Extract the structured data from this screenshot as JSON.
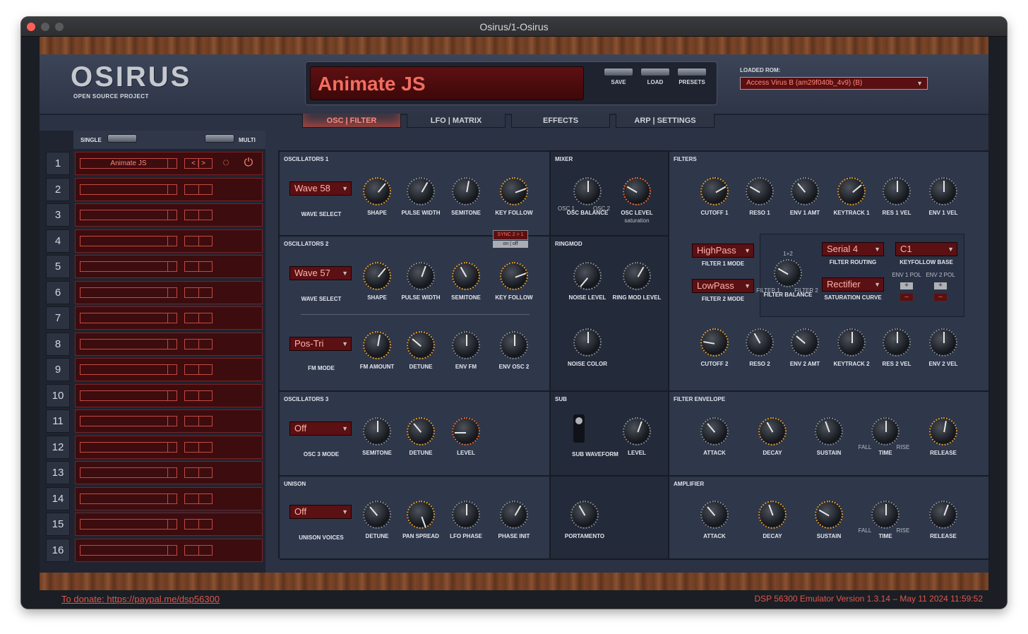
{
  "window": {
    "title": "Osirus/1-Osirus"
  },
  "header": {
    "logo": "OSIRUS",
    "logo_sub": "OPEN SOURCE PROJECT",
    "patch_name": "Animate JS",
    "buttons": [
      "SAVE",
      "LOAD",
      "PRESETS"
    ],
    "rom_label": "LOADED ROM:",
    "rom_value": "Access Virus B (am29f040b_4v9) (B)"
  },
  "tabs": [
    "OSC | FILTER",
    "LFO | MATRIX",
    "EFFECTS",
    "ARP | SETTINGS"
  ],
  "sidebar": {
    "single": "SINGLE",
    "multi": "MULTI",
    "slots": [
      "1",
      "2",
      "3",
      "4",
      "5",
      "6",
      "7",
      "8",
      "9",
      "10",
      "11",
      "12",
      "13",
      "14",
      "15",
      "16"
    ],
    "slot1_name": "Animate JS",
    "pm_label": "< | >"
  },
  "osc1": {
    "title": "OSCILLATORS 1",
    "wave": "Wave 58",
    "labels": [
      "WAVE SELECT",
      "SHAPE",
      "PULSE WIDTH",
      "SEMITONE",
      "KEY FOLLOW"
    ]
  },
  "osc2": {
    "title": "OSCILLATORS 2",
    "wave": "Wave 57",
    "labels": [
      "WAVE SELECT",
      "SHAPE",
      "PULSE WIDTH",
      "SEMITONE",
      "KEY FOLLOW"
    ],
    "sync": "SYNC 2 > 1",
    "onoff": "on | off",
    "fm_mode": "Pos-Tri",
    "labels2": [
      "FM MODE",
      "FM AMOUNT",
      "DETUNE",
      "ENV FM",
      "ENV OSC 2"
    ]
  },
  "osc3": {
    "title": "OSCILLATORS 3",
    "mode": "Off",
    "labels": [
      "OSC 3 MODE",
      "SEMITONE",
      "DETUNE",
      "LEVEL"
    ]
  },
  "unison": {
    "title": "UNISON",
    "voices": "Off",
    "labels": [
      "UNISON VOICES",
      "DETUNE",
      "PAN SPREAD",
      "LFO PHASE",
      "PHASE INIT"
    ]
  },
  "mixer": {
    "title": "MIXER",
    "labels": [
      "OSC BALANCE",
      "OSC LEVEL"
    ],
    "sat": "saturation",
    "osc1": "OSC 1",
    "osc2": "OSC 2"
  },
  "ringmod": {
    "title": "RINGMOD",
    "labels": [
      "NOISE LEVEL",
      "RING MOD LEVEL",
      "NOISE COLOR"
    ]
  },
  "sub": {
    "title": "SUB",
    "labels": [
      "SUB WAVEFORM",
      "LEVEL"
    ]
  },
  "portamento": {
    "label": "PORTAMENTO"
  },
  "filters": {
    "title": "FILTERS",
    "row1": [
      "CUTOFF 1",
      "RESO 1",
      "ENV 1 AMT",
      "KEYTRACK 1",
      "RES 1 VEL",
      "ENV 1 VEL"
    ],
    "row2": [
      "CUTOFF 2",
      "RESO 2",
      "ENV 2 AMT",
      "KEYTRACK 2",
      "RES 2 VEL",
      "ENV 2 VEL"
    ],
    "f1mode": "HighPass",
    "f1mode_lbl": "FILTER 1 MODE",
    "f2mode": "LowPass",
    "f2mode_lbl": "FILTER 2 MODE",
    "balance_lbl": "FILTER BALANCE",
    "routing": "Serial 4",
    "routing_lbl": "FILTER ROUTING",
    "sat": "Rectifier",
    "sat_lbl": "SATURATION CURVE",
    "kfb": "C1",
    "kfb_lbl": "KEYFOLLOW BASE",
    "env1pol": "ENV 1 POL",
    "env2pol": "ENV 2 POL",
    "f1": "FILTER 1",
    "f2": "FILTER 2",
    "f12": "1+2"
  },
  "filter_env": {
    "title": "FILTER ENVELOPE",
    "labels": [
      "ATTACK",
      "DECAY",
      "SUSTAIN",
      "TIME",
      "RELEASE"
    ],
    "fall": "FALL",
    "rise": "RISE"
  },
  "amplifier": {
    "title": "AMPLIFIER",
    "labels": [
      "ATTACK",
      "DECAY",
      "SUSTAIN",
      "TIME",
      "RELEASE"
    ],
    "fall": "FALL",
    "rise": "RISE"
  },
  "footer": {
    "donate": "To donate: https://paypal.me/dsp56300",
    "version": "DSP 56300 Emulator Version 1.3.14 – May 11 2024 11:59:52"
  }
}
